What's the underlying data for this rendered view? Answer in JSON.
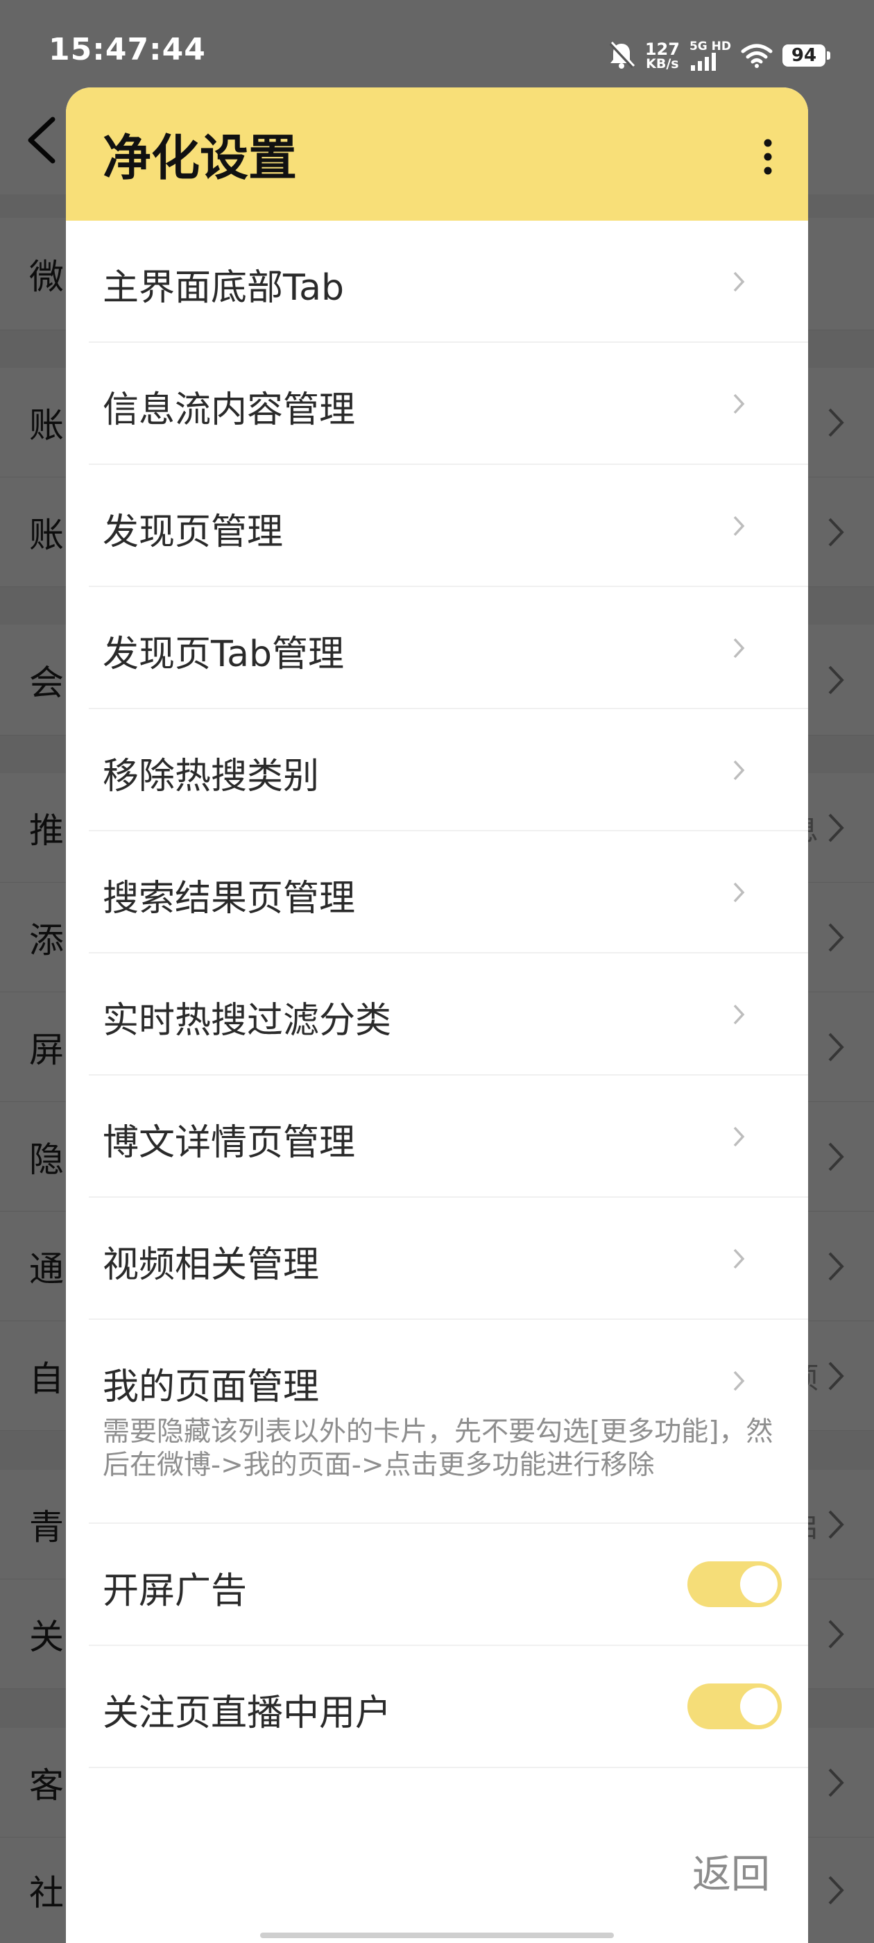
{
  "status_bar": {
    "time": "15:47:44",
    "speed_value": "127",
    "speed_unit": "KB/s",
    "network_label": "5G HD",
    "battery": "94",
    "icons": [
      "bell-off-icon",
      "signal-icon",
      "wifi-icon",
      "battery-icon"
    ]
  },
  "background": {
    "row_chars": [
      "微",
      "账",
      "账",
      "会",
      "推",
      "添",
      "屏",
      "隐",
      "通",
      "自",
      "青",
      "关",
      "客",
      "社"
    ],
    "row_values": [
      "",
      "",
      "",
      "",
      "息",
      "",
      "",
      "",
      "",
      "项",
      "启",
      "",
      "",
      ""
    ]
  },
  "dialog": {
    "title": "净化设置",
    "items": [
      {
        "label": "主界面底部Tab"
      },
      {
        "label": "信息流内容管理"
      },
      {
        "label": "发现页管理"
      },
      {
        "label": "发现页Tab管理"
      },
      {
        "label": "移除热搜类别"
      },
      {
        "label": "搜索结果页管理"
      },
      {
        "label": "实时热搜过滤分类"
      },
      {
        "label": "博文详情页管理"
      },
      {
        "label": "视频相关管理"
      },
      {
        "label": "我的页面管理",
        "description": "需要隐藏该列表以外的卡片，先不要勾选[更多功能]，然后在微博->我的页面->点击更多功能进行移除"
      }
    ],
    "toggles": [
      {
        "label": "开屏广告",
        "on": true
      },
      {
        "label": "关注页直播中用户",
        "on": true
      }
    ],
    "back_label": "返回"
  },
  "colors": {
    "header": "#f8df78",
    "toggle_on": "#f5dd78",
    "scrim": "rgba(0,0,0,0.60)"
  }
}
